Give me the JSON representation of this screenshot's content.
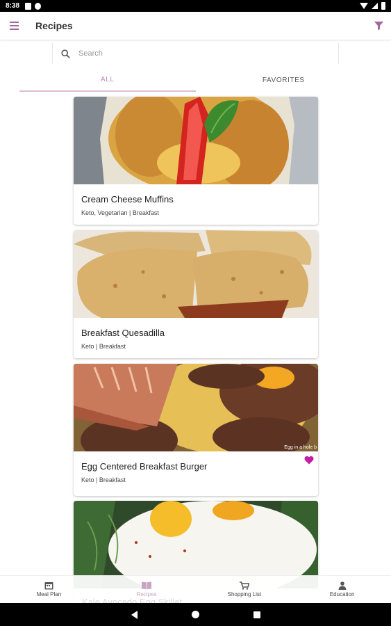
{
  "status": {
    "time": "8:38"
  },
  "app_bar": {
    "title": "Recipes"
  },
  "search": {
    "placeholder": "Search",
    "value": ""
  },
  "tabs": [
    {
      "label": "ALL",
      "active": true
    },
    {
      "label": "FAVORITES",
      "active": false
    }
  ],
  "recipes": [
    {
      "title": "Cream Cheese Muffins",
      "tags": "Keto, Vegetarian | Breakfast",
      "favorite": false,
      "image_caption": ""
    },
    {
      "title": "Breakfast Quesadilla",
      "tags": "Keto | Breakfast",
      "favorite": false,
      "image_caption": ""
    },
    {
      "title": "Egg Centered Breakfast Burger",
      "tags": "Keto | Breakfast",
      "favorite": true,
      "image_caption": "Egg in a hole b"
    },
    {
      "title": "Kale Avocado Egg Skillet",
      "tags": "",
      "favorite": false,
      "image_caption": ""
    }
  ],
  "bottom_nav": [
    {
      "label": "Meal Plan",
      "icon": "calendar-icon",
      "active": false
    },
    {
      "label": "Recipes",
      "icon": "book-icon",
      "active": true
    },
    {
      "label": "Shopping List",
      "icon": "cart-icon",
      "active": false
    },
    {
      "label": "Education",
      "icon": "person-icon",
      "active": false
    }
  ],
  "colors": {
    "accent": "#a06a9a",
    "heart": "#c21ea8",
    "tab_active": "#c08ab8"
  }
}
